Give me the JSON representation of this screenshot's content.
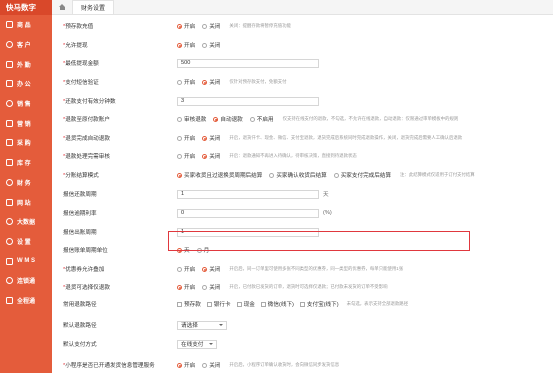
{
  "app": {
    "title": "快马数字"
  },
  "sidebar": {
    "items": [
      {
        "label": "商 品",
        "icon": "box-icon"
      },
      {
        "label": "客 户",
        "icon": "user-icon"
      },
      {
        "label": "外 勤",
        "icon": "field-icon"
      },
      {
        "label": "办 公",
        "icon": "office-icon"
      },
      {
        "label": "销 售",
        "icon": "sales-icon"
      },
      {
        "label": "营 销",
        "icon": "marketing-icon"
      },
      {
        "label": "采 购",
        "icon": "purchase-icon"
      },
      {
        "label": "库 存",
        "icon": "inventory-icon"
      },
      {
        "label": "财 务",
        "icon": "finance-icon"
      },
      {
        "label": "网 站",
        "icon": "website-icon"
      },
      {
        "label": "大数据",
        "icon": "bigdata-icon"
      },
      {
        "label": "设 置",
        "icon": "settings-icon"
      },
      {
        "label": "W M S",
        "icon": "wms-icon"
      },
      {
        "label": "连锁通",
        "icon": "chain-icon"
      },
      {
        "label": "全程通",
        "icon": "process-icon"
      }
    ]
  },
  "topbar": {
    "tab_label": "财务设置"
  },
  "form": {
    "prepay_topup": {
      "label": "预存款充值",
      "on": "开启",
      "off": "关闭",
      "hint": "关闭：提醒存款将暂停充值功能"
    },
    "allow_withdraw": {
      "label": "允许提现",
      "on": "开启",
      "off": "关闭"
    },
    "min_withdraw": {
      "label": "最低提现金额",
      "value": "500"
    },
    "pay_sms": {
      "label": "支付短信验证",
      "on": "开启",
      "off": "关闭",
      "hint": "仅针对预存款支付，免额支付"
    },
    "refund_days": {
      "label": "还款支付有效分钟数",
      "value": "3"
    },
    "refund_original": {
      "label": "退款至原付款账户",
      "opt1": "审核退款",
      "opt2": "自动退款",
      "opt3": "不启用",
      "hint": "仅支持在线支付的退款，不勾选，不允许在线退款，自动退款：仅限通过审单模板中的规则"
    },
    "refund_after_done": {
      "label": "退货完成自动退款",
      "on": "开启",
      "off": "关闭",
      "hint": "开启，退货仟卡、现金、微信、支付宝退款，退货完成后系统同时完成退款操作，关闭，退货完成后需要人工确认后退款"
    },
    "refund_audit": {
      "label": "退款处理完需审核",
      "on": "开启",
      "off": "关闭",
      "hint": "开启：退款通知不再进入待确认，待审核决策，直接到待退款状态"
    },
    "split_settle": {
      "label": "分账结算模式",
      "opt1": "买家收货且过退换货周期后结算",
      "opt2": "买家确认收货后结算",
      "opt3": "买家支付完成后结算",
      "hint": "注：此结算模式仅适用于订付支付结算"
    },
    "repay_period": {
      "label": "报信还款周期",
      "value": "1",
      "unit": "天"
    },
    "overdue_rate": {
      "label": "报信逾期利率",
      "value": "0",
      "unit": "(%)"
    },
    "bill_period": {
      "label": "报信出账周期",
      "value": "1"
    },
    "bill_unit": {
      "label": "报信账单周期单位",
      "opt1": "天",
      "opt2": "月"
    },
    "coupon_stack": {
      "label": "优惠券允许叠加",
      "on": "开启",
      "off": "关闭",
      "hint": "开启后，同一订单里可使用多张不同类型的优惠券，同一类型的优惠券，每单只能使用1张"
    },
    "goods_return": {
      "label": "退货可选择仅退款",
      "on": "开启",
      "off": "关闭",
      "hint": "开启，已付款已发货的订单，退货时可选择仅退款；已付款未发货的订单不受影响"
    },
    "common_refund_path": {
      "label": "常用退款路径",
      "opt1": "预存款",
      "opt2": "银行卡",
      "opt3": "现金",
      "opt4": "微信(线下)",
      "opt5": "支付宝(线下)",
      "hint": "未勾选，表示支持全部退款路径"
    },
    "default_refund_path": {
      "label": "默认退款路径",
      "value": "请选择"
    },
    "default_pay_method": {
      "label": "默认支付方式",
      "value": "在线支付"
    },
    "miniapp_deliver": {
      "label": "小程序是否已开通发货信息管理服务",
      "on": "开启",
      "off": "关闭",
      "hint": "开启后，小程序订单确认收货时，会向微信同步发货信息"
    }
  }
}
